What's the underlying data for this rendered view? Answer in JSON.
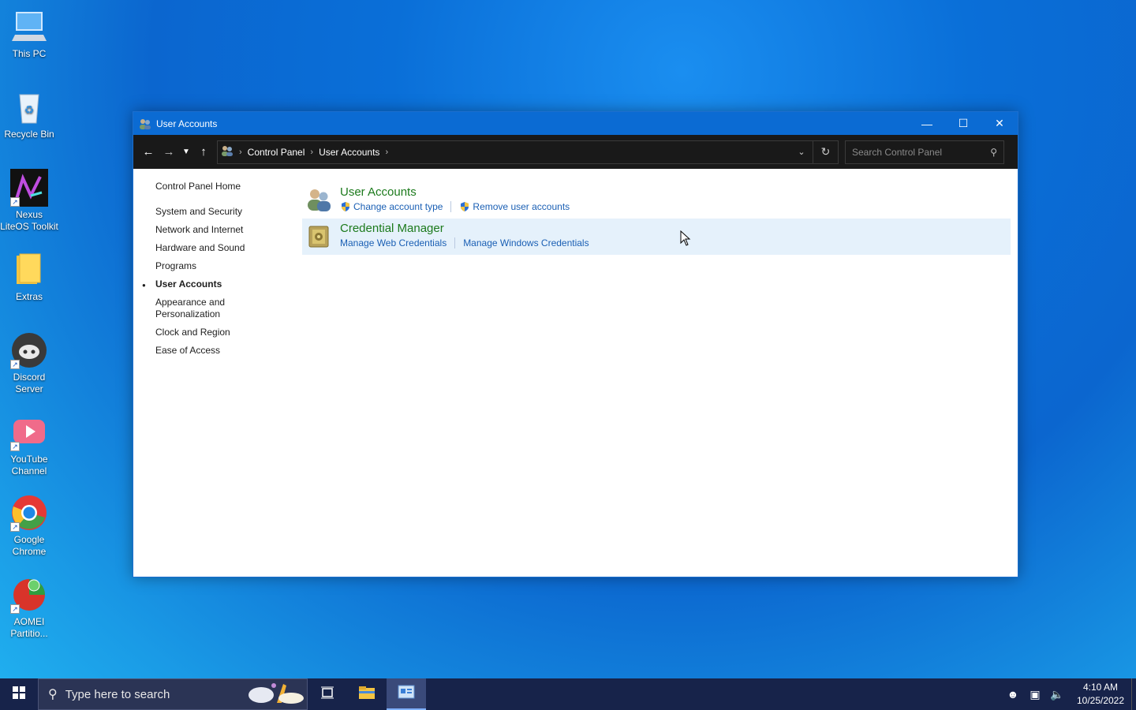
{
  "desktop": {
    "icons": [
      {
        "label": "This PC",
        "icon": "computer-icon"
      },
      {
        "label": "Recycle Bin",
        "icon": "recycle-bin-icon"
      },
      {
        "label": "Nexus LiteOS Toolkit",
        "icon": "nexus-app-icon"
      },
      {
        "label": "Extras",
        "icon": "folder-icon"
      },
      {
        "label": "Discord Server",
        "icon": "discord-icon"
      },
      {
        "label": "YouTube Channel",
        "icon": "youtube-icon"
      },
      {
        "label": "Google Chrome",
        "icon": "chrome-icon"
      },
      {
        "label": "AOMEI Partitio...",
        "icon": "aomei-icon"
      }
    ]
  },
  "window": {
    "title": "User Accounts",
    "breadcrumb": [
      "Control Panel",
      "User Accounts"
    ],
    "search_placeholder": "Search Control Panel"
  },
  "sidebar": {
    "home": "Control Panel Home",
    "items": [
      {
        "label": "System and Security",
        "active": false
      },
      {
        "label": "Network and Internet",
        "active": false
      },
      {
        "label": "Hardware and Sound",
        "active": false
      },
      {
        "label": "Programs",
        "active": false
      },
      {
        "label": "User Accounts",
        "active": true
      },
      {
        "label": "Appearance and Personalization",
        "active": false
      },
      {
        "label": "Clock and Region",
        "active": false
      },
      {
        "label": "Ease of Access",
        "active": false
      }
    ]
  },
  "categories": [
    {
      "title": "User Accounts",
      "icon": "users-icon",
      "links": [
        {
          "label": "Change account type",
          "shield": true
        },
        {
          "label": "Remove user accounts",
          "shield": true
        }
      ]
    },
    {
      "title": "Credential Manager",
      "icon": "vault-icon",
      "links": [
        {
          "label": "Manage Web Credentials",
          "shield": false
        },
        {
          "label": "Manage Windows Credentials",
          "shield": false
        }
      ]
    }
  ],
  "taskbar": {
    "search_placeholder": "Type here to search",
    "time": "4:10 AM",
    "date": "10/25/2022"
  },
  "colors": {
    "titlebar": "#0b6bd3",
    "category_title": "#1c7a1c",
    "link": "#1a5fb4",
    "hover_row": "#e5f1fb"
  }
}
